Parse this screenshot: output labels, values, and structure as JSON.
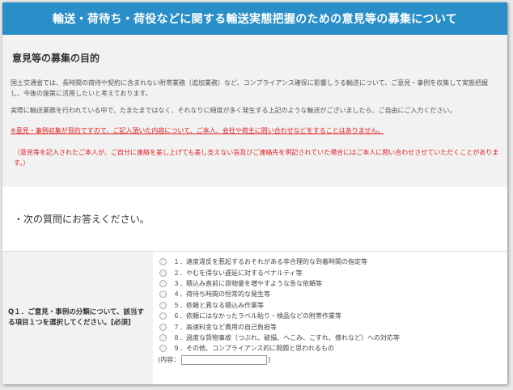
{
  "header": {
    "title": "輸送・荷待ち・荷役などに関する輸送実態把握のための意見等の募集について"
  },
  "purpose": {
    "heading": "意見等の募集の目的",
    "para1": "国土交通省では、長時間の荷待や契約に含まれない附帯業務（追加業務）など、コンプライアンス確保に影響しうる輸送について、ご意見・事例を収集して実態把握し、今後の施策に活用したいと考えております。",
    "para2": "実際に輸送業務を行われている中で、たまたまではなく、それなりに頻度が多く発生する上記のような輸送がございましたら、ご自由にご入力ください。",
    "note1": "※意見・事例収集が目的ですので、ご記入頂いた内容について、ご本人、会社や荷主に問い合わせなどをすることはありません。",
    "note2": "（意見等を記入されたご本人が、ご自分に連絡を差し上げても差し支えない旨及びご連絡先を明記されていた場合にはご本人に問い合わせさせていただくことがあります。）"
  },
  "prompt": "・次の質問にお答えください。",
  "question": {
    "label": "Q１．ご意見・事例の分類について、該当する項目１つを選択してください。[必須]",
    "options": [
      "１．速度違反を惹起するおそれがある非合理的な到着時間の指定等",
      "２．やむを得ない遅延に対するペナルティ等",
      "３．積込み直前に貨物量を増やすような急な依頼等",
      "４．荷待ち時間の恒常的な発生等",
      "５．依頼と異なる積込み作業等",
      "６．依頼にはなかったラベル貼り・検品などの附帯作業等",
      "７．高速料金など費用の自己負担等",
      "８．過度な貨物事故（つぶれ、破損、へこみ、こすれ、擦れなど）への対応等",
      "９．その他、コンプライアンス的に問題と思われるもの"
    ],
    "other_prefix": "(内容：",
    "other_suffix": ")",
    "other_value": ""
  }
}
